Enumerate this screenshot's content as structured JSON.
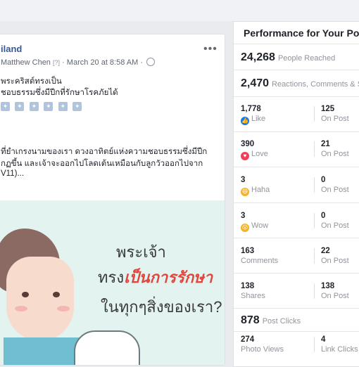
{
  "post": {
    "page_name": "iland",
    "author": "Matthew Chen",
    "author_badge": "[?]",
    "timestamp": "March 20 at 8:58 AM",
    "more_label": "•••",
    "text_lines": [
      "พระคริสต์ทรงเป็น",
      "ชอบธรรมซึ่งมีปีกที่รักษาโรคภัยได้",
      "ที่ยำเกรงนามของเรา ดวงอาทิตย์แห่งความชอบธรรมซึ่งมีปีก",
      "กฏขึ้น และเจ้าจะออกไปโลดเต้นเหมือนกับลูกวัวออกไปจาก",
      "V11)..."
    ],
    "image_text": {
      "line1": "พระเจ้า",
      "line2_prefix": "ทรง",
      "line2_highlight": "เป็นการรักษา",
      "line3": "ในทุกๆสิ่งของเรา?"
    }
  },
  "performance": {
    "title": "Performance for Your Po",
    "reached": {
      "value": "24,268",
      "label": "People Reached"
    },
    "reactions_total": {
      "value": "2,470",
      "label": "Reactions, Comments & S"
    },
    "rows": [
      {
        "left_value": "1,778",
        "left_label": "Like",
        "left_icon": "like-icon",
        "right_value": "125",
        "right_label": "On Post"
      },
      {
        "left_value": "390",
        "left_label": "Love",
        "left_icon": "love-icon",
        "right_value": "21",
        "right_label": "On Post"
      },
      {
        "left_value": "3",
        "left_label": "Haha",
        "left_icon": "haha-icon",
        "right_value": "0",
        "right_label": "On Post"
      },
      {
        "left_value": "3",
        "left_label": "Wow",
        "left_icon": "wow-icon",
        "right_value": "0",
        "right_label": "On Post"
      },
      {
        "left_value": "163",
        "left_label": "Comments",
        "left_icon": "",
        "right_value": "22",
        "right_label": "On Post"
      },
      {
        "left_value": "138",
        "left_label": "Shares",
        "left_icon": "",
        "right_value": "138",
        "right_label": "On Post"
      }
    ],
    "post_clicks": {
      "value": "878",
      "label": "Post Clicks"
    },
    "clicks_rows": [
      {
        "left_value": "274",
        "left_label": "Photo Views",
        "right_value": "4",
        "right_label": "Link Clicks"
      }
    ]
  },
  "colors": {
    "accent": "#385898",
    "like": "#1877f2",
    "love": "#f33e58",
    "haha": "#f7b125",
    "image_highlight": "#e0473e"
  }
}
